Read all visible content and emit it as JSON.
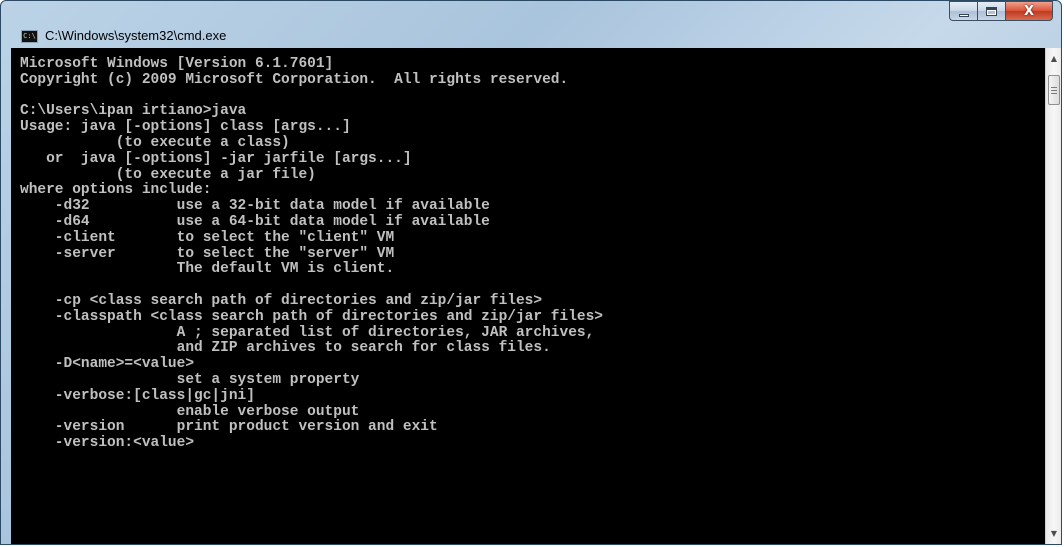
{
  "window": {
    "title": "C:\\Windows\\system32\\cmd.exe",
    "icon": "cmd-icon",
    "icon_label": "C:\\",
    "close_glyph": "X"
  },
  "colors": {
    "console_bg": "#000000",
    "console_fg": "#C0C0C0",
    "close_button": "#C13A20"
  },
  "console": {
    "lines": [
      "Microsoft Windows [Version 6.1.7601]",
      "Copyright (c) 2009 Microsoft Corporation.  All rights reserved.",
      "",
      "C:\\Users\\ipan irtiano>java",
      "Usage: java [-options] class [args...]",
      "           (to execute a class)",
      "   or  java [-options] -jar jarfile [args...]",
      "           (to execute a jar file)",
      "where options include:",
      "    -d32          use a 32-bit data model if available",
      "    -d64          use a 64-bit data model if available",
      "    -client       to select the \"client\" VM",
      "    -server       to select the \"server\" VM",
      "                  The default VM is client.",
      "",
      "    -cp <class search path of directories and zip/jar files>",
      "    -classpath <class search path of directories and zip/jar files>",
      "                  A ; separated list of directories, JAR archives,",
      "                  and ZIP archives to search for class files.",
      "    -D<name>=<value>",
      "                  set a system property",
      "    -verbose:[class|gc|jni]",
      "                  enable verbose output",
      "    -version      print product version and exit",
      "    -version:<value>"
    ]
  },
  "scrollbar": {
    "up_arrow": "▲",
    "down_arrow": "▼"
  }
}
